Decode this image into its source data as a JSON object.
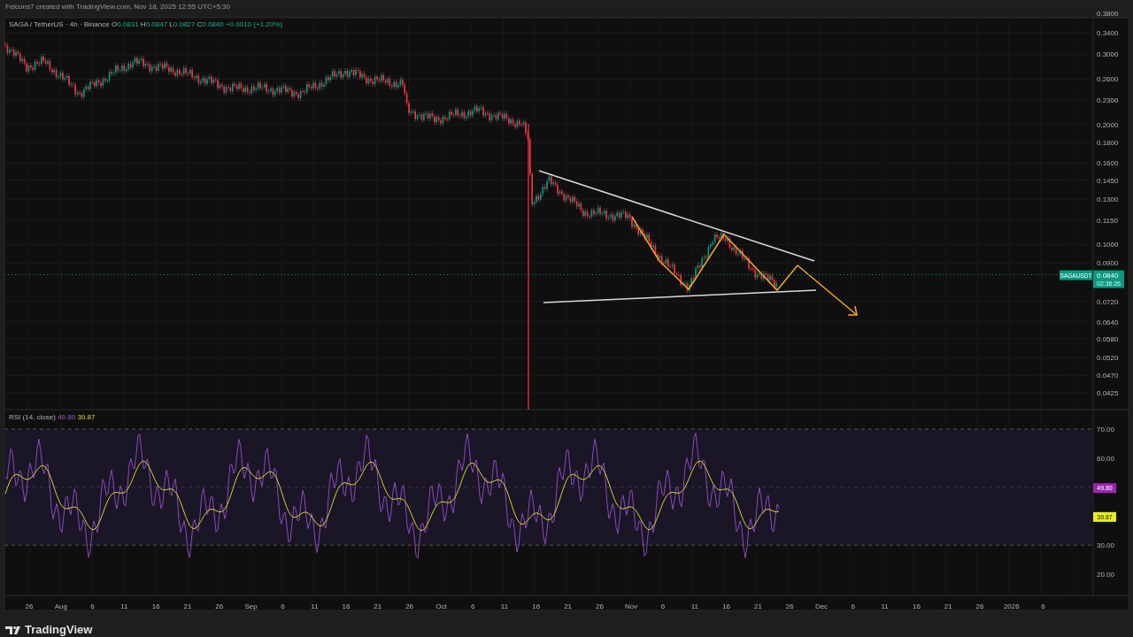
{
  "author_line": "Felcons7 created with TradingView.com, Nov 18, 2025 12:55 UTC+5:30",
  "legend": {
    "symbol": "SAGA / TetherUS · 4h · Binance",
    "ohlc": [
      {
        "label": "O",
        "value": "0.0831"
      },
      {
        "label": "H",
        "value": "0.0847"
      },
      {
        "label": "L",
        "value": "0.0827"
      },
      {
        "label": "C",
        "value": "0.0840"
      }
    ],
    "change": "+0.0010 (+1.20%)"
  },
  "price_axis": {
    "ticks": [
      "0.3800",
      "0.3400",
      "0.3000",
      "0.2600",
      "0.2300",
      "0.2000",
      "0.1800",
      "0.1600",
      "0.1450",
      "0.1300",
      "0.1150",
      "0.1000",
      "0.0900",
      "0.0720",
      "0.0640",
      "0.0580",
      "0.0520",
      "0.0470",
      "0.0425"
    ],
    "last_price": {
      "symbol": "SAGAUSDT",
      "price": "0.0840",
      "countdown": "02:36:26"
    }
  },
  "rsi": {
    "title": "RSI (14, close)",
    "value": "49.80",
    "ma_value": "39.87",
    "ticks": [
      "70.00",
      "60.00",
      "30.00",
      "20.00"
    ],
    "value_tag": "49.80",
    "ma_tag": "39.87"
  },
  "time_axis": [
    "26",
    "Aug",
    "6",
    "11",
    "16",
    "21",
    "26",
    "Sep",
    "6",
    "11",
    "16",
    "21",
    "26",
    "Oct",
    "6",
    "11",
    "16",
    "21",
    "26",
    "Nov",
    "6",
    "11",
    "16",
    "21",
    "26",
    "Dec",
    "6",
    "11",
    "16",
    "21",
    "26",
    "2026",
    "6"
  ],
  "footer": {
    "logo": "TradingView"
  }
}
